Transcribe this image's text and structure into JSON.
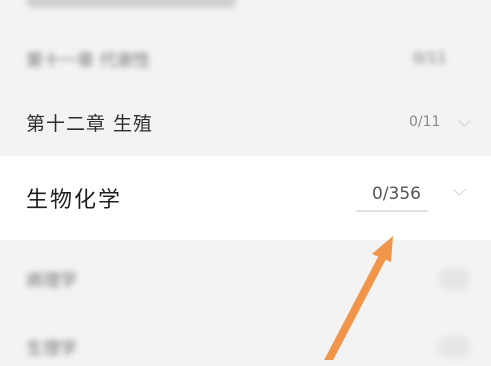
{
  "chapters": [
    {
      "title": "第十一章 代谢性",
      "count": "0/11",
      "blurred": true
    },
    {
      "title": "第十二章 生殖",
      "count": "0/11",
      "blurred": false
    }
  ],
  "highlighted": {
    "title": "生物化学",
    "count": "0/356",
    "chevron": "chevron-down-icon"
  },
  "lower": [
    {
      "title": "病理学",
      "blurred": true
    },
    {
      "title": "生理学",
      "blurred": true
    }
  ],
  "overlay": {
    "arrow_color": "#f0954a"
  }
}
